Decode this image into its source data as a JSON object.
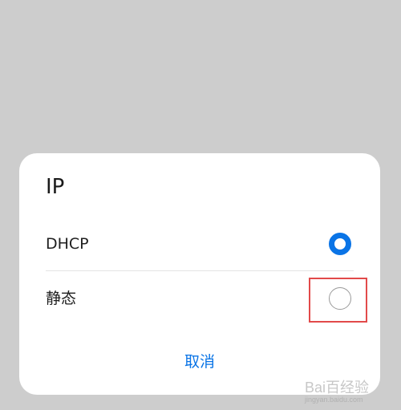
{
  "dialog": {
    "title": "IP",
    "options": [
      {
        "label": "DHCP",
        "selected": true
      },
      {
        "label": "静态",
        "selected": false
      }
    ],
    "cancel_label": "取消"
  },
  "colors": {
    "accent": "#0a74e6",
    "highlight": "#e24a4a",
    "scrim": "#cdcdcd"
  },
  "watermark": {
    "logo": "Bai百经验",
    "sub": "jingyan.baidu.com"
  }
}
